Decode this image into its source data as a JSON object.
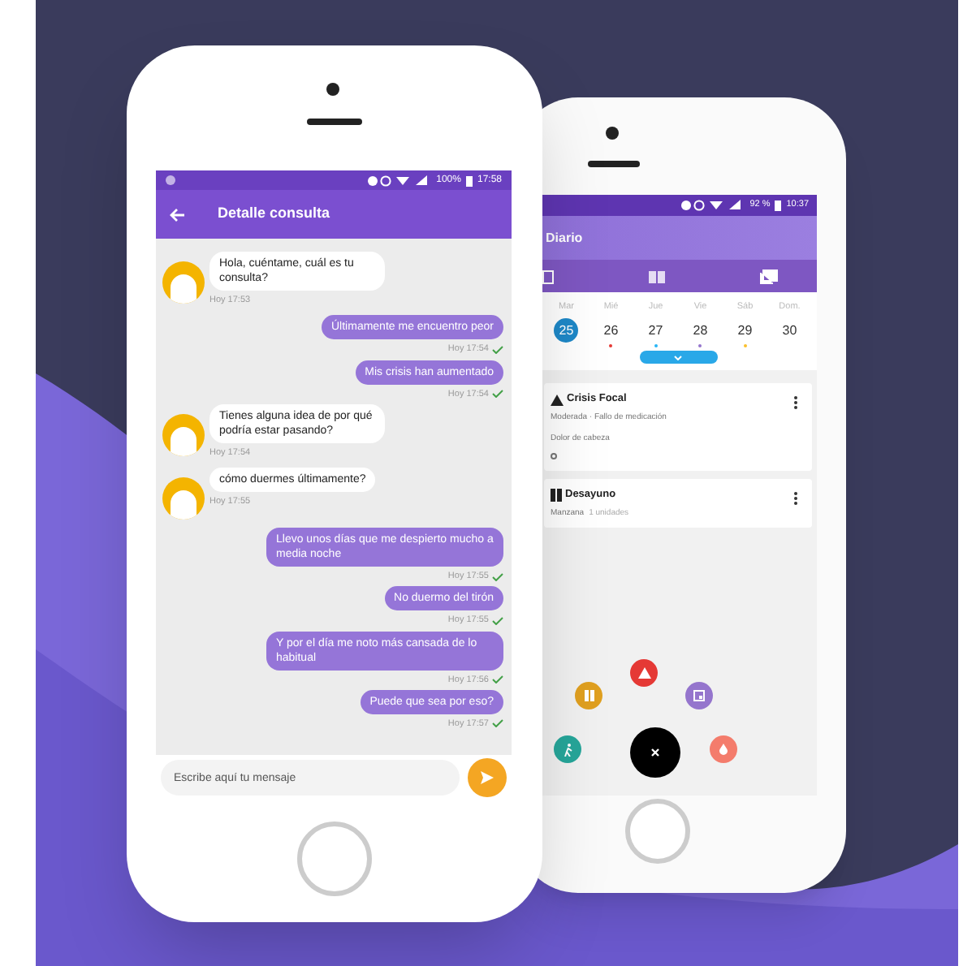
{
  "chat_phone": {
    "status_bar": {
      "battery": "100%",
      "time": "17:58"
    },
    "header": {
      "title": "Detalle consulta"
    },
    "messages": [
      {
        "kind": "received",
        "text": "Hola, cuéntame, cuál es tu consulta?",
        "time": "Hoy 17:53"
      },
      {
        "kind": "sent",
        "text": "Últimamente me encuentro peor",
        "time": "Hoy 17:54",
        "read": true
      },
      {
        "kind": "sent",
        "text": "Mis crisis han aumentado",
        "time": "Hoy 17:54",
        "read": true
      },
      {
        "kind": "received",
        "text": "Tienes alguna idea de por qué podría estar pasando?",
        "time": "Hoy 17:54"
      },
      {
        "kind": "received",
        "text": "cómo duermes últimamente?",
        "time": "Hoy 17:55"
      },
      {
        "kind": "sent",
        "text": "Llevo unos días que me despierto mucho a media noche",
        "time": "Hoy 17:55",
        "read": true
      },
      {
        "kind": "sent",
        "text": "No duermo del tirón",
        "time": "Hoy 17:55",
        "read": true
      },
      {
        "kind": "sent",
        "text": "Y por el día me noto más cansada de lo habitual",
        "time": "Hoy 17:56",
        "read": true
      },
      {
        "kind": "sent",
        "text": "Puede que sea por eso?",
        "time": "Hoy 17:57",
        "read": true
      }
    ],
    "input": {
      "placeholder": "Escribe aquí tu mensaje"
    }
  },
  "diary_phone": {
    "status_bar": {
      "battery": "92 %",
      "time": "10:37"
    },
    "header": {
      "title": "Diario"
    },
    "calendar": {
      "days": [
        {
          "name": "Mar",
          "number": "25",
          "selected": true
        },
        {
          "name": "Mié",
          "number": "26",
          "selected": false,
          "color": "#e53935"
        },
        {
          "name": "Jue",
          "number": "27",
          "selected": false,
          "color": "#29b6f6"
        },
        {
          "name": "Vie",
          "number": "28",
          "selected": false,
          "color": "#9575cd"
        },
        {
          "name": "Sáb",
          "number": "29",
          "selected": false,
          "color": "#fbc02d"
        },
        {
          "name": "Dom.",
          "number": "30",
          "selected": false
        }
      ]
    },
    "entries": [
      {
        "kind": "crisis",
        "title": "Crisis Focal",
        "subtitle": "Moderada · Fallo de medicación",
        "note": "Dolor de cabeza"
      },
      {
        "kind": "meal",
        "title": "Desayuno",
        "subtitle": "Manzana",
        "detail": "1 unidades"
      }
    ],
    "fab_actions": [
      {
        "kind": "meal",
        "color": "#e0a020"
      },
      {
        "kind": "crisis",
        "color": "#e53935"
      },
      {
        "kind": "calendar",
        "color": "#9575cd"
      },
      {
        "kind": "activity",
        "color": "#26a69a"
      },
      {
        "kind": "drop",
        "color": "#f47c6c"
      }
    ]
  }
}
